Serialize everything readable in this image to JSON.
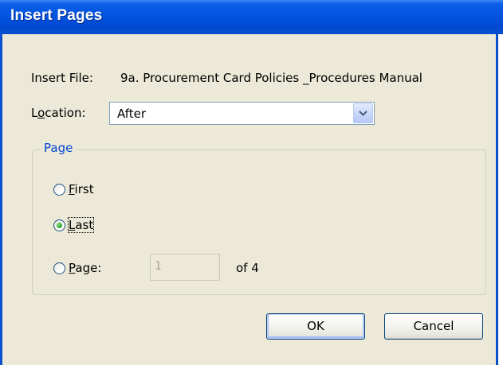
{
  "window": {
    "title": "Insert Pages"
  },
  "insert_file": {
    "label": "Insert File:",
    "value": "9a. Procurement Card Policies _Procedures Manual"
  },
  "location": {
    "label_pre": "L",
    "label_u": "o",
    "label_post": "cation:",
    "selected": "After"
  },
  "page_group": {
    "legend": "Page",
    "first": {
      "u": "F",
      "rest": "irst",
      "checked": false
    },
    "last": {
      "u": "L",
      "rest": "ast",
      "checked": true
    },
    "page": {
      "u": "P",
      "rest": "age:",
      "checked": false,
      "value": "1",
      "of_label": "of 4"
    }
  },
  "buttons": {
    "ok": "OK",
    "cancel": "Cancel"
  },
  "colors": {
    "titlebar": "#0354e0",
    "dialog_bg": "#ece9d8",
    "legend": "#0046d5"
  },
  "icons": {
    "dropdown": "chevron-down-icon"
  }
}
